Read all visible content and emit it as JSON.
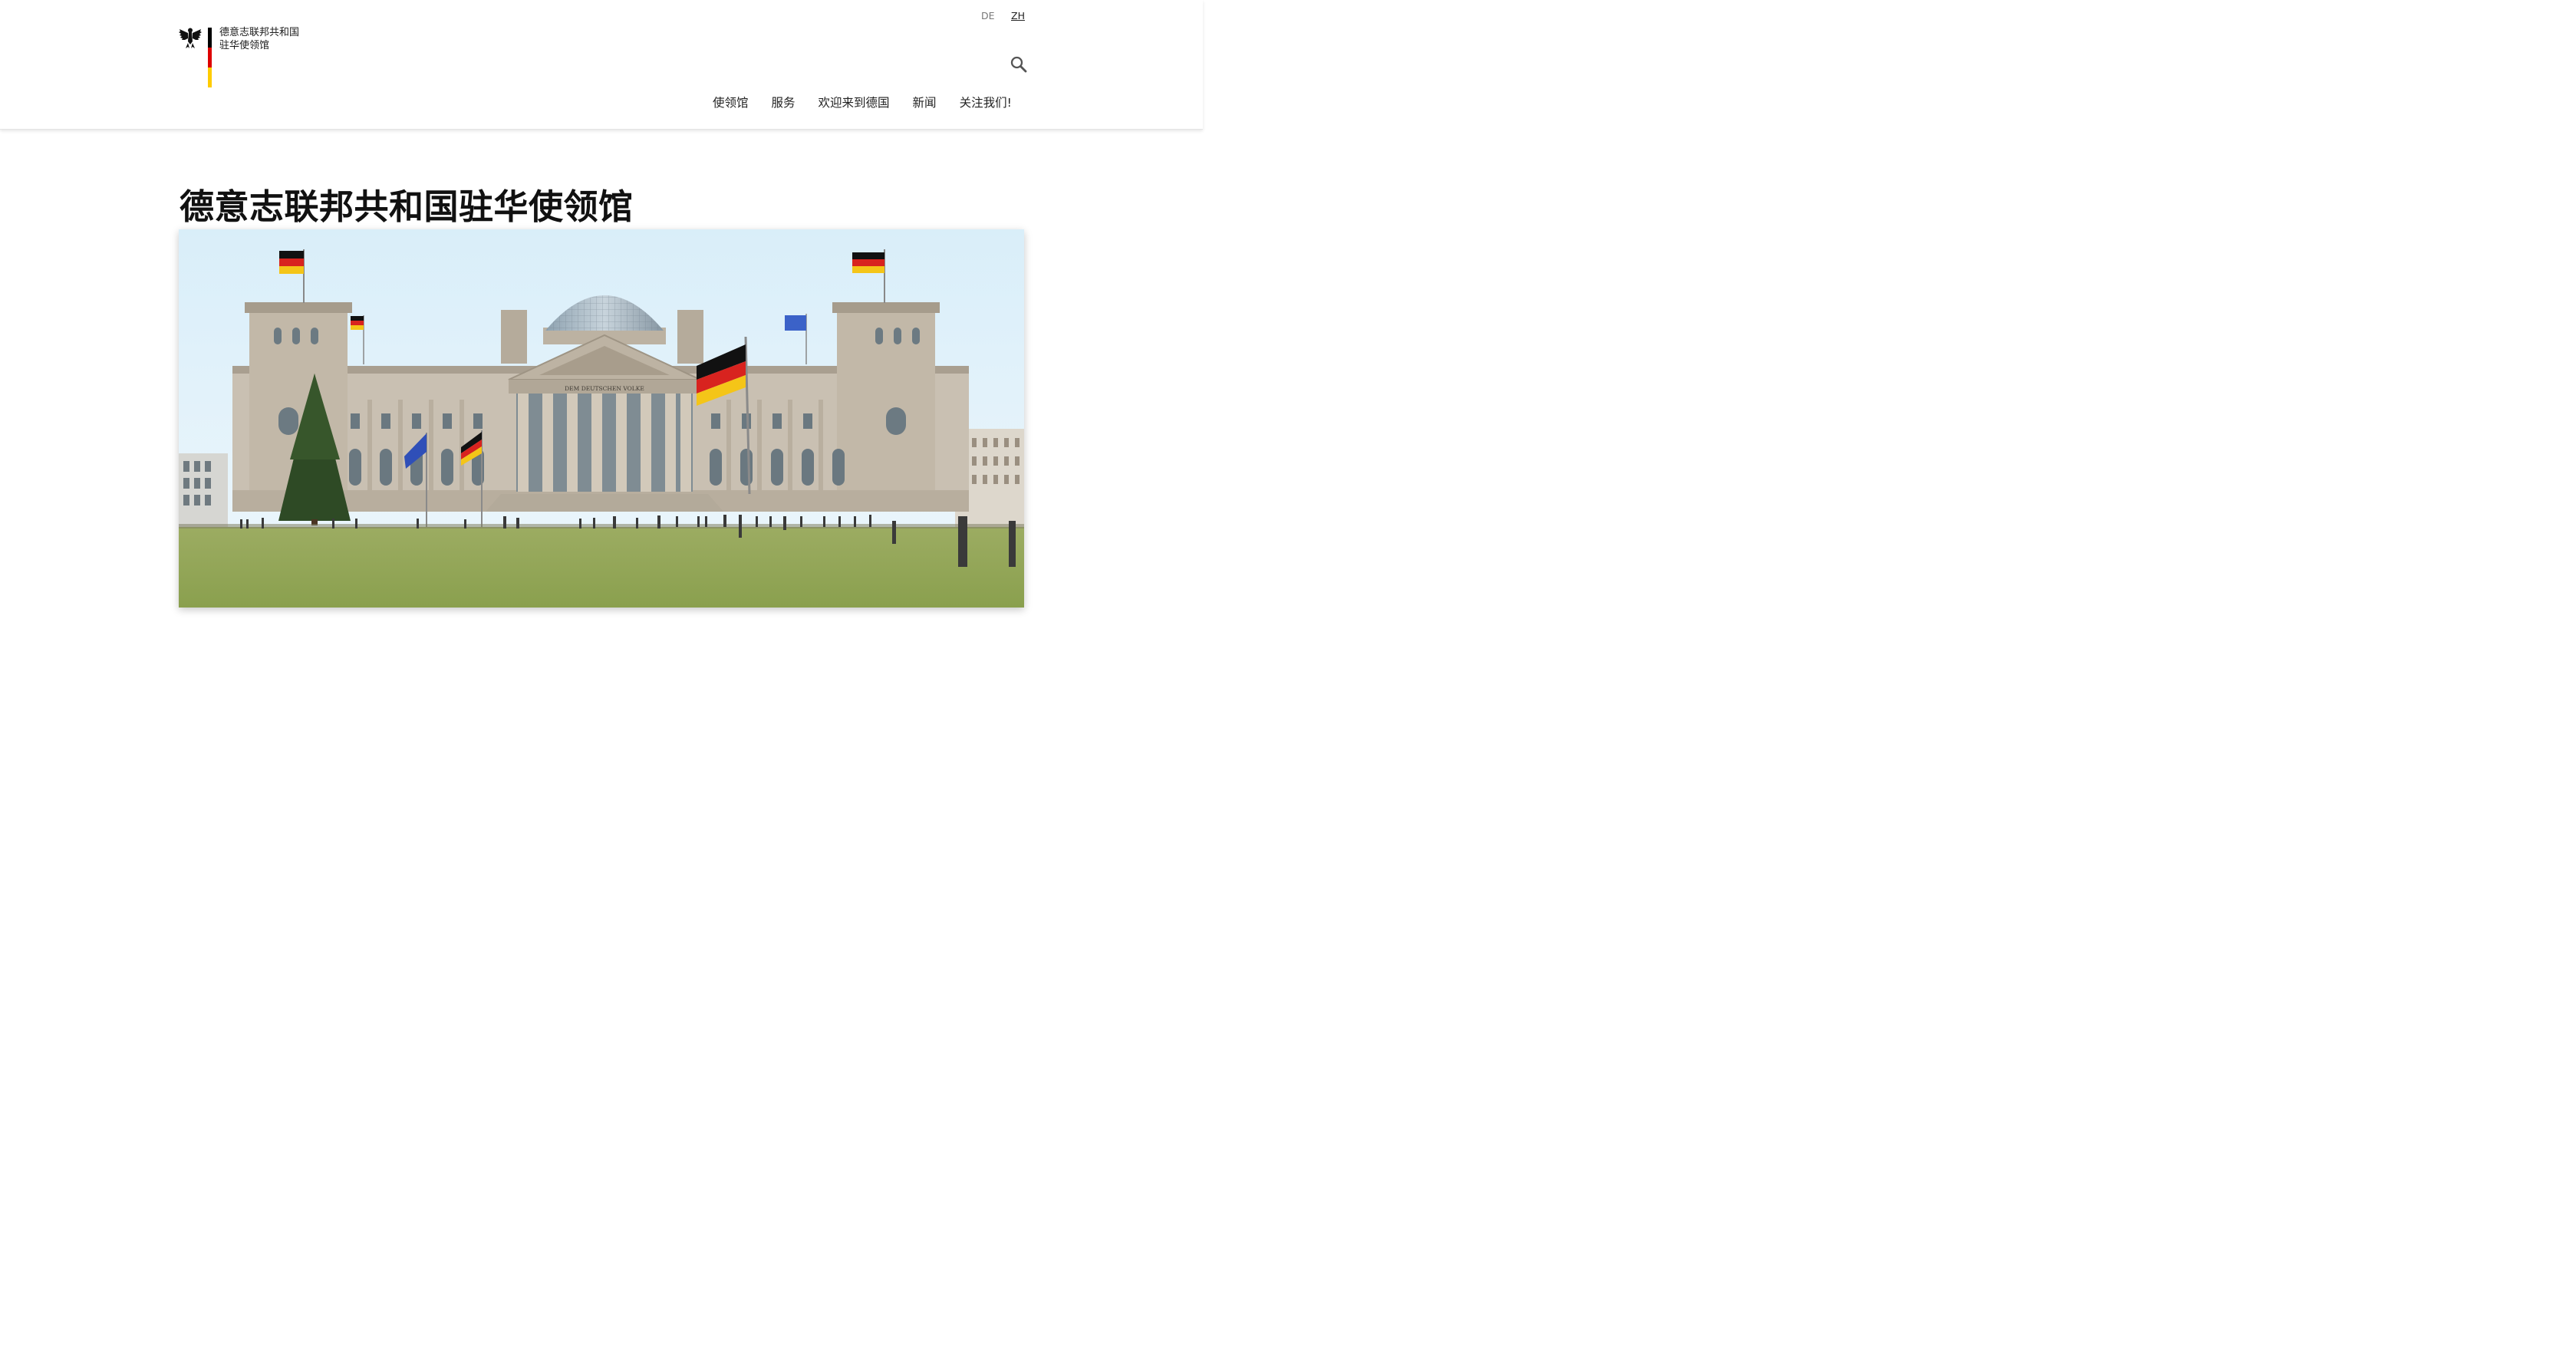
{
  "brand": {
    "line1": "德意志联邦共和国",
    "line2": "驻华使领馆",
    "flag_colors": [
      "#000000",
      "#dd0000",
      "#ffcc00"
    ]
  },
  "language": {
    "options": [
      "DE",
      "ZH"
    ],
    "selected": "ZH"
  },
  "header": {
    "search_icon": "search-icon"
  },
  "nav": {
    "items": [
      {
        "label": "使领馆"
      },
      {
        "label": "服务"
      },
      {
        "label": "欢迎来到德国"
      },
      {
        "label": "新闻"
      },
      {
        "label": "关注我们!"
      }
    ]
  },
  "main": {
    "title": "德意志联邦共和国驻华使领馆",
    "hero": {
      "pediment_inscription": "DEM DEUTSCHEN VOLKE"
    }
  }
}
